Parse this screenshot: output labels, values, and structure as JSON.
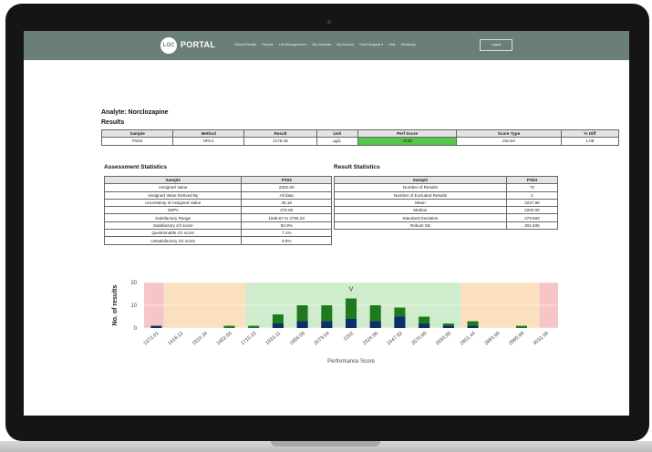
{
  "nav": {
    "brand": "LGC",
    "portal": "PORTAL",
    "items": [
      "Submit Results",
      "Reports",
      "Lab Management ▾",
      "My Schedule",
      "My Account",
      "Trend Analysis ▾",
      "Help",
      "Workshop"
    ],
    "logout": "Logout"
  },
  "analyte": "Analyte: Norclozapine",
  "results_heading": "Results",
  "results_table": {
    "headers": [
      "Sample",
      "Method",
      "Result",
      "Unit",
      "Perf Score",
      "Score Type",
      "% Diff"
    ],
    "row": [
      "PS04",
      "HPLC",
      "2178.25",
      "µg/L",
      "-0.09",
      "zScore",
      "1.08"
    ],
    "perf_color": "#57c54b"
  },
  "assessment": {
    "title": "Assessment Statistics",
    "headers": [
      "Sample",
      "PS04"
    ],
    "rows": [
      [
        "Assigned Value",
        "2202.00"
      ],
      [
        "Assigned Value Derived By",
        "All data"
      ],
      [
        "Uncertainty of Assigned Value",
        "45.18"
      ],
      [
        "SDPA",
        "276.66"
      ],
      [
        "Satisfactory Range",
        "1648.67 to 2755.33"
      ],
      [
        "Satisfactory z/z score",
        "92.9%"
      ],
      [
        "Questionable z/z score",
        "7.1%"
      ],
      [
        "Unsatisfactory z/z score",
        "0.0%"
      ]
    ]
  },
  "result_stats": {
    "title": "Result Statistics",
    "headers": [
      "Sample",
      "PS04"
    ],
    "rows": [
      [
        "Number of Results",
        "72"
      ],
      [
        "Number of Excluded Results",
        "2"
      ],
      [
        "Mean",
        "2227.86"
      ],
      [
        "Median",
        "2202.00"
      ],
      [
        "Standard Deviation",
        "279.683"
      ],
      [
        "Robust SD",
        "302.406"
      ]
    ]
  },
  "chart_data": {
    "type": "bar",
    "title": "",
    "xlabel": "Performance Score",
    "ylabel": "No. of results",
    "ylim": [
      0,
      20
    ],
    "yticks": [
      0,
      10,
      20
    ],
    "categories": [
      "1372.01",
      "1418.12",
      "1510.34",
      "1602.56",
      "1710.15",
      "1833.11",
      "1956.08",
      "2079.04",
      "2202",
      "2324.96",
      "2447.92",
      "2570.89",
      "2693.85",
      "2801.44",
      "2893.66",
      "2985.88",
      "3031.99"
    ],
    "series": [
      {
        "color": "#1f7a1f",
        "values": [
          0,
          0,
          0,
          1,
          1,
          6,
          10,
          10,
          13,
          10,
          9,
          5,
          2,
          3,
          0,
          1,
          0
        ]
      },
      {
        "color": "#0c2e6e",
        "values": [
          1,
          0,
          0,
          0,
          0,
          2,
          3,
          3,
          4,
          3,
          5,
          2,
          1,
          1,
          0,
          0,
          0
        ]
      }
    ],
    "marker": {
      "label": "V",
      "category": "2202"
    },
    "zones": [
      {
        "color": "#f6c6c6",
        "from": 0.0,
        "to": 0.048
      },
      {
        "color": "#fbe0c0",
        "from": 0.048,
        "to": 0.245
      },
      {
        "color": "#cfeccd",
        "from": 0.245,
        "to": 0.765
      },
      {
        "color": "#fbe0c0",
        "from": 0.765,
        "to": 0.955
      },
      {
        "color": "#f6c6c6",
        "from": 0.955,
        "to": 1.0
      }
    ]
  }
}
